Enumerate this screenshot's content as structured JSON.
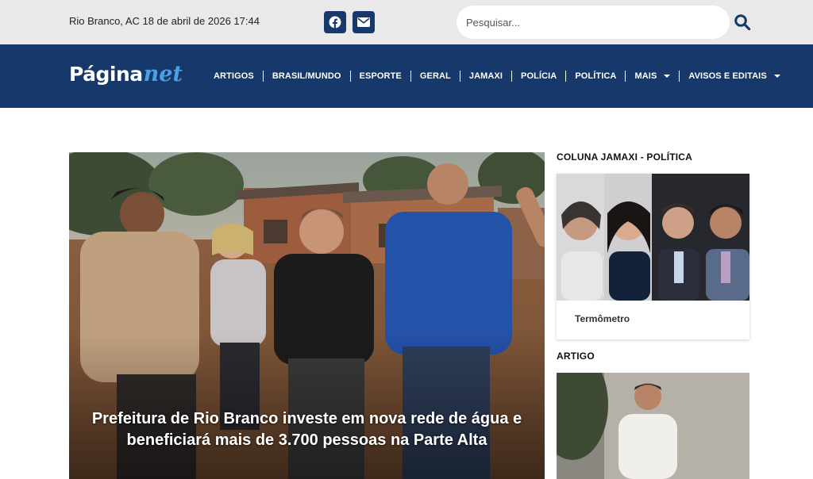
{
  "topbar": {
    "datetime": "Rio Branco, AC 18 de abril de 2026 17:44",
    "social": [
      {
        "icon": "facebook-icon"
      },
      {
        "icon": "email-icon"
      }
    ],
    "search": {
      "placeholder": "Pesquisar...",
      "value": ""
    }
  },
  "logo": {
    "main": "Página",
    "accent": "net"
  },
  "menu": {
    "items": [
      {
        "label": "ARTIGOS"
      },
      {
        "label": "BRASIL/MUNDO"
      },
      {
        "label": "ESPORTE"
      },
      {
        "label": "GERAL"
      },
      {
        "label": "JAMAXI"
      },
      {
        "label": "POLÍCIA"
      },
      {
        "label": "POLÍTICA"
      },
      {
        "label": "MAIS",
        "dropdown": true
      },
      {
        "label": "AVISOS E EDITAIS",
        "dropdown": true
      }
    ]
  },
  "hero": {
    "title": "Prefeitura de Rio Branco investe em nova rede de água e beneficiará mais de 3.700 pessoas na Parte Alta"
  },
  "sidebar": {
    "section1": {
      "title": "COLUNA JAMAXI - POLÍTICA",
      "card_label": "Termômetro"
    },
    "section2": {
      "title": "ARTIGO"
    }
  },
  "colors": {
    "brand_navy": "#16386a",
    "logo_accent": "#4aa0e6",
    "topbar_bg": "#e9e9e9"
  }
}
